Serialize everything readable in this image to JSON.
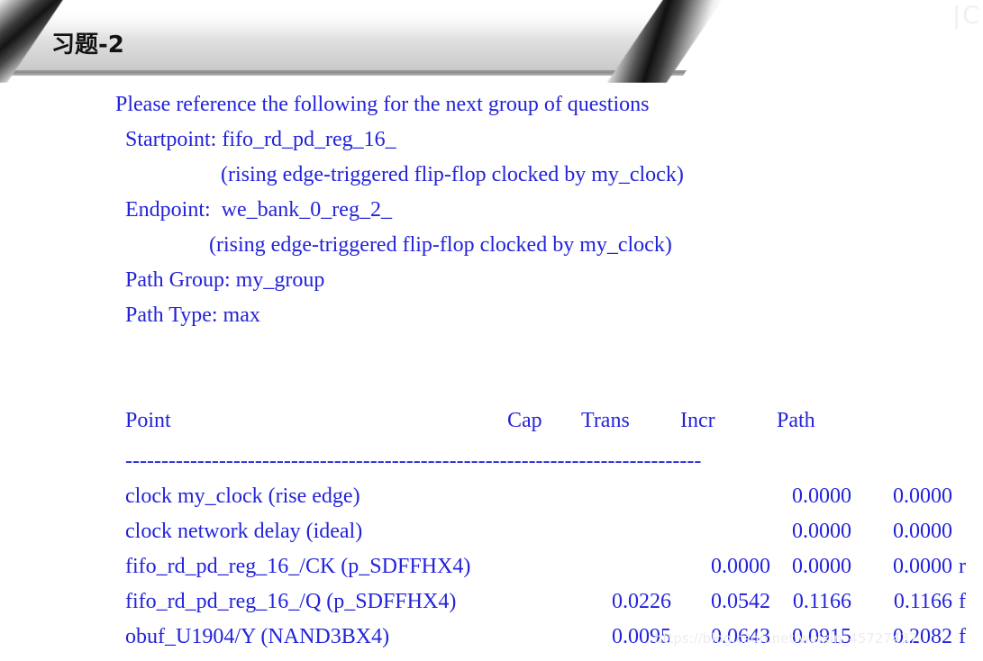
{
  "slide": {
    "title": "习题-2",
    "corner_watermark": "|C",
    "url_watermark": "https://blog.csdn.net/weixin_45727437",
    "text_color": "#2323da",
    "title_color": "#121212"
  },
  "intro": {
    "line": "Please reference the following for the next group of questions"
  },
  "path_info": {
    "startpoint": "Startpoint: fifo_rd_pd_reg_16_",
    "startpoint_note": "(rising edge-triggered flip-flop clocked by my_clock)",
    "endpoint": "Endpoint:  we_bank_0_reg_2_",
    "endpoint_note": "(rising edge-triggered flip-flop clocked by my_clock)",
    "path_group": "Path Group: my_group",
    "path_type": "Path Type: max"
  },
  "report": {
    "headers": {
      "point": "Point",
      "cap": "Cap",
      "trans": "Trans",
      "incr": "Incr",
      "path": "Path"
    },
    "separator": "--------------------------------------------------------------------------------",
    "rows": [
      {
        "point": "clock my_clock (rise edge)",
        "cap": "",
        "trans": "",
        "incr": "0.0000",
        "path": "0.0000",
        "edge": ""
      },
      {
        "point": "clock network delay (ideal)",
        "cap": "",
        "trans": "",
        "incr": "0.0000",
        "path": "0.0000",
        "edge": ""
      },
      {
        "point": "fifo_rd_pd_reg_16_/CK (p_SDFFHX4)",
        "cap": "",
        "trans": "0.0000",
        "incr": "0.0000",
        "path": "0.0000",
        "edge": "r"
      },
      {
        "point": "fifo_rd_pd_reg_16_/Q (p_SDFFHX4)",
        "cap": "0.0226",
        "trans": "0.0542",
        "incr": "0.1166",
        "path": "0.1166",
        "edge": "f"
      },
      {
        "point": "obuf_U1904/Y (NAND3BX4)",
        "cap": "0.0095",
        "trans": "0.0643",
        "incr": "0.0915",
        "path": "0.2082",
        "edge": "f"
      }
    ]
  }
}
